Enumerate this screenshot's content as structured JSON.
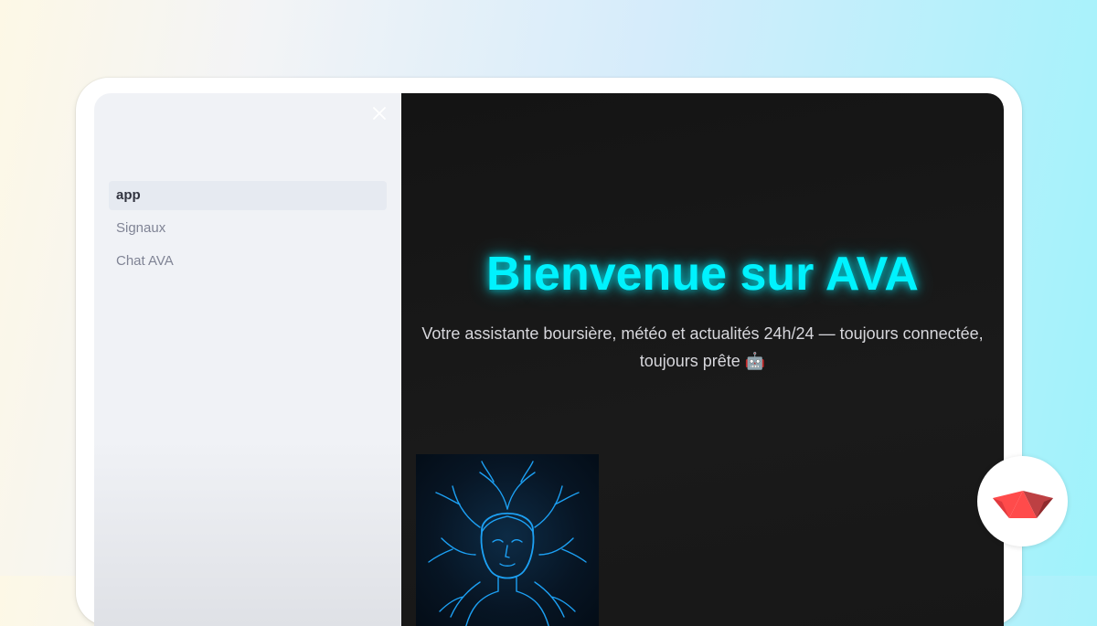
{
  "sidebar": {
    "close_icon": "close-icon",
    "nav_items": [
      {
        "label": "app",
        "active": true
      },
      {
        "label": "Signaux",
        "active": false
      },
      {
        "label": "Chat AVA",
        "active": false
      }
    ]
  },
  "main": {
    "title": "Bienvenue sur AVA",
    "subtitle_line1": "Votre assistante boursière, météo et actualités 24h/24 — toujours connectée,",
    "subtitle_line2": "toujours prête 🤖",
    "avatar_icon": "ai-face-illustration"
  },
  "badge": {
    "icon": "streamlit-crown-logo"
  },
  "colors": {
    "accent": "#00f2fe",
    "sidebar_bg": "#f0f2f6",
    "main_bg": "#161616",
    "active_item_bg": "#e6eaf1",
    "logo_red": "#ff4b4b"
  }
}
